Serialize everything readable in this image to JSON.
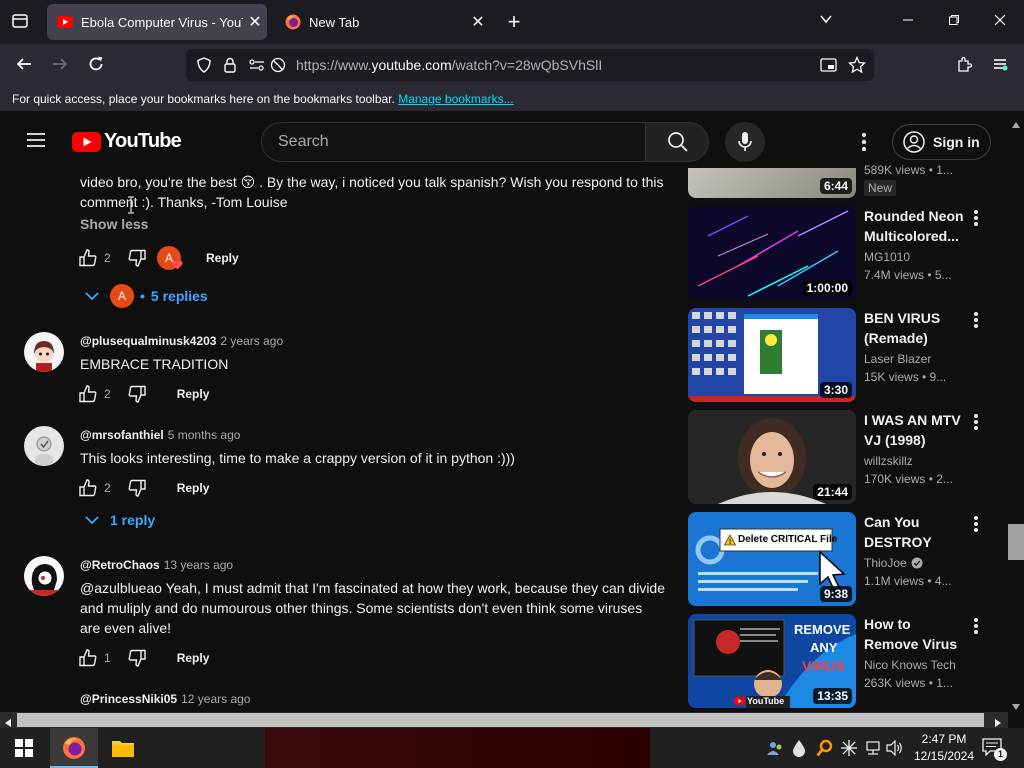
{
  "browser": {
    "tabs": [
      {
        "title": "Ebola Computer Virus - YouTube",
        "active": true
      },
      {
        "title": "New Tab",
        "active": false
      }
    ],
    "url_prefix": "https://www.",
    "url_host": "youtube.com",
    "url_path": "/watch?v=28wQbSVhSlI",
    "bookmarks_text": "For quick access, place your bookmarks here on the bookmarks toolbar.",
    "bookmarks_link": "Manage bookmarks..."
  },
  "youtube": {
    "logo_text": "YouTube",
    "search_placeholder": "Search",
    "signin_label": "Sign in"
  },
  "comments": {
    "top_text": "video bro, you're the best 😚 . By the way, i noticed you talk spanish? Wish you respond to this comment :). Thanks, -Tom Louise",
    "show_less": "Show less",
    "top_likes": "2",
    "top_replies": "5 replies",
    "creator_avatar_letter": "A",
    "reply_label": "Reply",
    "items": [
      {
        "author": "@plusequalminusk4203",
        "ago": "2 years ago",
        "text": "EMBRACE TRADITION",
        "likes": "2"
      },
      {
        "author": "@mrsofanthiel",
        "ago": "5 months ago",
        "text": "This looks interesting, time to make a crappy version of it in python :)))",
        "likes": "2",
        "replies": "1 reply"
      },
      {
        "author": "@RetroChaos",
        "ago": "13 years ago",
        "text": "@azulblueao Yeah, I must admit that I'm fascinated at how they work, because they can divide and muliply and do numourous other things. Some scientists don't even think some viruses are even alive!",
        "likes": "1"
      },
      {
        "author": "@PrincessNiki05",
        "ago": "12 years ago"
      }
    ]
  },
  "sidebar": {
    "partial": {
      "duration": "6:44",
      "meta": "589K views • 1...",
      "badge": "New"
    },
    "videos": [
      {
        "title": "Rounded Neon Multicolored...",
        "channel": "MG1010",
        "meta": "7.4M views • 5...",
        "duration": "1:00:00"
      },
      {
        "title": "BEN VIRUS (Remade)",
        "channel": "Laser Blazer",
        "meta": "15K views • 9...",
        "duration": "3:30"
      },
      {
        "title": "I WAS AN MTV VJ (1998)",
        "channel": "willzskillz",
        "meta": "170K views • 2...",
        "duration": "21:44"
      },
      {
        "title": "Can You DESTROY You...",
        "channel": "ThioJoe",
        "meta": "1.1M views • 4...",
        "duration": "9:38",
        "thumb_text": "Delete CRITICAL File"
      },
      {
        "title": "How to Remove Virus from PC...",
        "channel": "Nico Knows Tech",
        "meta": "263K views • 1...",
        "duration": "13:35",
        "thumb_text_1": "REMOVE",
        "thumb_text_2": "ANY",
        "thumb_text_3": "VIRUS",
        "thumb_brand": "YouTube"
      }
    ]
  },
  "taskbar": {
    "time": "2:47 PM",
    "date": "12/15/2024",
    "notif_count": "1"
  },
  "colors": {
    "accent_link": "#3ea6ff",
    "yt_red": "#ff0000",
    "bookmark_link": "#00ddff"
  }
}
